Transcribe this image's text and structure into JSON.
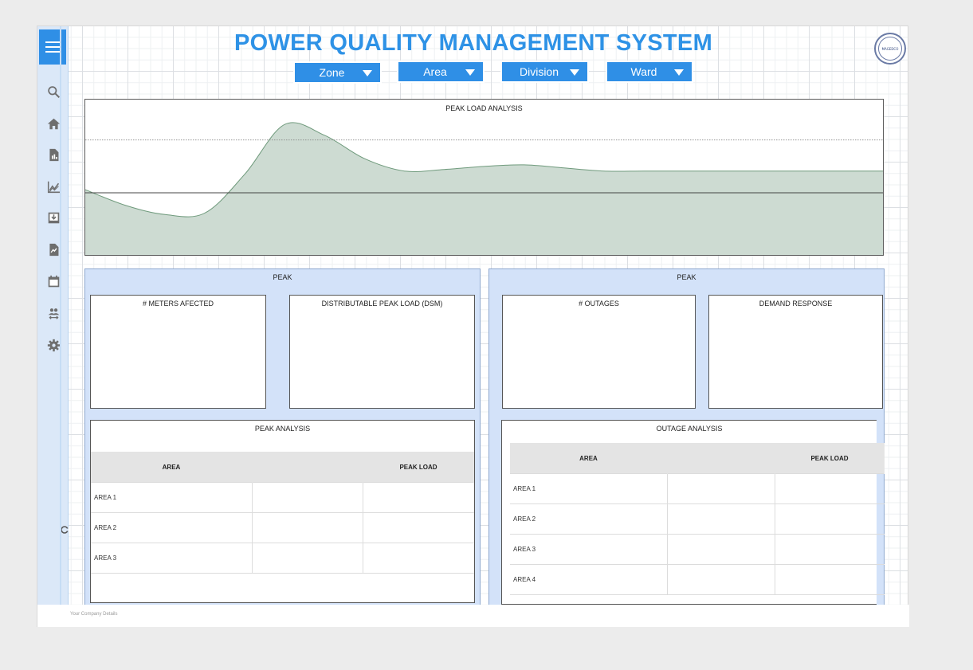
{
  "app": {
    "title": "POWER QUALITY MANAGEMENT SYSTEM",
    "logo_text": "MAGEDCO",
    "footer": "Your Company Details"
  },
  "sidebar": {
    "items": [
      {
        "name": "menu",
        "icon": "hamburger-icon"
      },
      {
        "name": "search",
        "icon": "search-icon"
      },
      {
        "name": "home",
        "icon": "home-icon"
      },
      {
        "name": "reports",
        "icon": "report-file-icon"
      },
      {
        "name": "analytics",
        "icon": "line-chart-icon"
      },
      {
        "name": "inbox",
        "icon": "download-tray-icon"
      },
      {
        "name": "documents",
        "icon": "document-chart-icon"
      },
      {
        "name": "calendar",
        "icon": "calendar-icon"
      },
      {
        "name": "users",
        "icon": "people-icon"
      },
      {
        "name": "settings",
        "icon": "gear-icon"
      }
    ]
  },
  "filters": [
    {
      "label": "Zone"
    },
    {
      "label": "Area"
    },
    {
      "label": "Division"
    },
    {
      "label": "Ward"
    }
  ],
  "chart": {
    "title": "PEAK LOAD ANALYSIS"
  },
  "chart_data": {
    "type": "area",
    "title": "PEAK LOAD ANALYSIS",
    "xlabel": "",
    "ylabel": "",
    "x": [
      0,
      1,
      2,
      3,
      4,
      5,
      6,
      7,
      8,
      9,
      10,
      11,
      12,
      13,
      14,
      15,
      16,
      17,
      18,
      19,
      20
    ],
    "series": [
      {
        "values": [
          42,
          32,
          26,
          27,
          52,
          84,
          77,
          62,
          54,
          55,
          57,
          58,
          56,
          54,
          54,
          54,
          54,
          54,
          54,
          54,
          54
        ]
      }
    ],
    "reference_lines": [
      {
        "value": 40,
        "style": "solid"
      },
      {
        "value": 74,
        "style": "dotted"
      }
    ],
    "ylim": [
      0,
      100
    ],
    "grid": false,
    "fill_color": "#cddbd2",
    "line_color": "#6f9a7c"
  },
  "left_panel": {
    "title": "PEAK",
    "kpi1": "# METERS AFECTED",
    "kpi2": "DISTRIBUTABLE PEAK LOAD (DSM)",
    "table": {
      "title": "PEAK ANALYSIS",
      "headers": [
        "AREA",
        "",
        "PEAK LOAD"
      ],
      "rows": [
        "AREA 1",
        "AREA 2",
        "AREA 3"
      ]
    }
  },
  "right_panel": {
    "title": "PEAK",
    "kpi1": "# OUTAGES",
    "kpi2": "DEMAND RESPONSE",
    "table": {
      "title": "OUTAGE ANALYSIS",
      "headers": [
        "AREA",
        "",
        "PEAK LOAD"
      ],
      "rows": [
        "AREA 1",
        "AREA 2",
        "AREA 3",
        "AREA 4"
      ]
    }
  },
  "colors": {
    "accent": "#2f8fe6",
    "panel_bg": "#d3e2f9",
    "sidebar_bg": "#dbe8f8"
  }
}
